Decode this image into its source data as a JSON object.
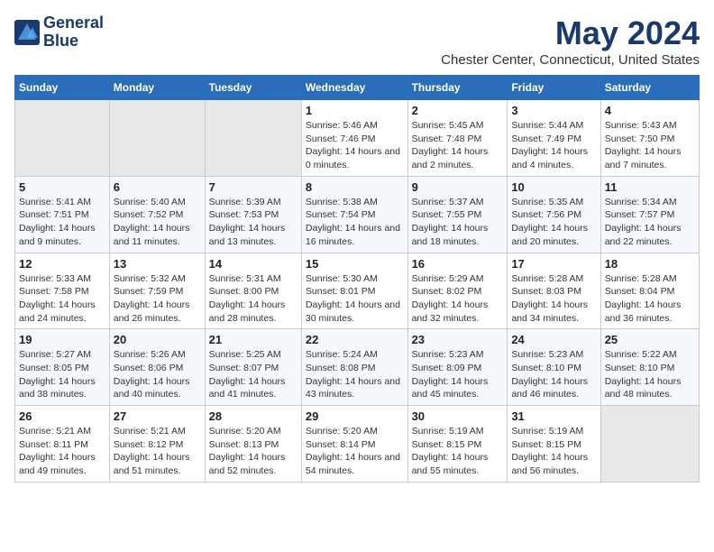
{
  "header": {
    "logo_line1": "General",
    "logo_line2": "Blue",
    "title": "May 2024",
    "subtitle": "Chester Center, Connecticut, United States"
  },
  "weekdays": [
    "Sunday",
    "Monday",
    "Tuesday",
    "Wednesday",
    "Thursday",
    "Friday",
    "Saturday"
  ],
  "weeks": [
    [
      {
        "day": "",
        "empty": true
      },
      {
        "day": "",
        "empty": true
      },
      {
        "day": "",
        "empty": true
      },
      {
        "day": "1",
        "sunrise": "Sunrise: 5:46 AM",
        "sunset": "Sunset: 7:46 PM",
        "daylight": "Daylight: 14 hours and 0 minutes."
      },
      {
        "day": "2",
        "sunrise": "Sunrise: 5:45 AM",
        "sunset": "Sunset: 7:48 PM",
        "daylight": "Daylight: 14 hours and 2 minutes."
      },
      {
        "day": "3",
        "sunrise": "Sunrise: 5:44 AM",
        "sunset": "Sunset: 7:49 PM",
        "daylight": "Daylight: 14 hours and 4 minutes."
      },
      {
        "day": "4",
        "sunrise": "Sunrise: 5:43 AM",
        "sunset": "Sunset: 7:50 PM",
        "daylight": "Daylight: 14 hours and 7 minutes."
      }
    ],
    [
      {
        "day": "5",
        "sunrise": "Sunrise: 5:41 AM",
        "sunset": "Sunset: 7:51 PM",
        "daylight": "Daylight: 14 hours and 9 minutes."
      },
      {
        "day": "6",
        "sunrise": "Sunrise: 5:40 AM",
        "sunset": "Sunset: 7:52 PM",
        "daylight": "Daylight: 14 hours and 11 minutes."
      },
      {
        "day": "7",
        "sunrise": "Sunrise: 5:39 AM",
        "sunset": "Sunset: 7:53 PM",
        "daylight": "Daylight: 14 hours and 13 minutes."
      },
      {
        "day": "8",
        "sunrise": "Sunrise: 5:38 AM",
        "sunset": "Sunset: 7:54 PM",
        "daylight": "Daylight: 14 hours and 16 minutes."
      },
      {
        "day": "9",
        "sunrise": "Sunrise: 5:37 AM",
        "sunset": "Sunset: 7:55 PM",
        "daylight": "Daylight: 14 hours and 18 minutes."
      },
      {
        "day": "10",
        "sunrise": "Sunrise: 5:35 AM",
        "sunset": "Sunset: 7:56 PM",
        "daylight": "Daylight: 14 hours and 20 minutes."
      },
      {
        "day": "11",
        "sunrise": "Sunrise: 5:34 AM",
        "sunset": "Sunset: 7:57 PM",
        "daylight": "Daylight: 14 hours and 22 minutes."
      }
    ],
    [
      {
        "day": "12",
        "sunrise": "Sunrise: 5:33 AM",
        "sunset": "Sunset: 7:58 PM",
        "daylight": "Daylight: 14 hours and 24 minutes."
      },
      {
        "day": "13",
        "sunrise": "Sunrise: 5:32 AM",
        "sunset": "Sunset: 7:59 PM",
        "daylight": "Daylight: 14 hours and 26 minutes."
      },
      {
        "day": "14",
        "sunrise": "Sunrise: 5:31 AM",
        "sunset": "Sunset: 8:00 PM",
        "daylight": "Daylight: 14 hours and 28 minutes."
      },
      {
        "day": "15",
        "sunrise": "Sunrise: 5:30 AM",
        "sunset": "Sunset: 8:01 PM",
        "daylight": "Daylight: 14 hours and 30 minutes."
      },
      {
        "day": "16",
        "sunrise": "Sunrise: 5:29 AM",
        "sunset": "Sunset: 8:02 PM",
        "daylight": "Daylight: 14 hours and 32 minutes."
      },
      {
        "day": "17",
        "sunrise": "Sunrise: 5:28 AM",
        "sunset": "Sunset: 8:03 PM",
        "daylight": "Daylight: 14 hours and 34 minutes."
      },
      {
        "day": "18",
        "sunrise": "Sunrise: 5:28 AM",
        "sunset": "Sunset: 8:04 PM",
        "daylight": "Daylight: 14 hours and 36 minutes."
      }
    ],
    [
      {
        "day": "19",
        "sunrise": "Sunrise: 5:27 AM",
        "sunset": "Sunset: 8:05 PM",
        "daylight": "Daylight: 14 hours and 38 minutes."
      },
      {
        "day": "20",
        "sunrise": "Sunrise: 5:26 AM",
        "sunset": "Sunset: 8:06 PM",
        "daylight": "Daylight: 14 hours and 40 minutes."
      },
      {
        "day": "21",
        "sunrise": "Sunrise: 5:25 AM",
        "sunset": "Sunset: 8:07 PM",
        "daylight": "Daylight: 14 hours and 41 minutes."
      },
      {
        "day": "22",
        "sunrise": "Sunrise: 5:24 AM",
        "sunset": "Sunset: 8:08 PM",
        "daylight": "Daylight: 14 hours and 43 minutes."
      },
      {
        "day": "23",
        "sunrise": "Sunrise: 5:23 AM",
        "sunset": "Sunset: 8:09 PM",
        "daylight": "Daylight: 14 hours and 45 minutes."
      },
      {
        "day": "24",
        "sunrise": "Sunrise: 5:23 AM",
        "sunset": "Sunset: 8:10 PM",
        "daylight": "Daylight: 14 hours and 46 minutes."
      },
      {
        "day": "25",
        "sunrise": "Sunrise: 5:22 AM",
        "sunset": "Sunset: 8:10 PM",
        "daylight": "Daylight: 14 hours and 48 minutes."
      }
    ],
    [
      {
        "day": "26",
        "sunrise": "Sunrise: 5:21 AM",
        "sunset": "Sunset: 8:11 PM",
        "daylight": "Daylight: 14 hours and 49 minutes."
      },
      {
        "day": "27",
        "sunrise": "Sunrise: 5:21 AM",
        "sunset": "Sunset: 8:12 PM",
        "daylight": "Daylight: 14 hours and 51 minutes."
      },
      {
        "day": "28",
        "sunrise": "Sunrise: 5:20 AM",
        "sunset": "Sunset: 8:13 PM",
        "daylight": "Daylight: 14 hours and 52 minutes."
      },
      {
        "day": "29",
        "sunrise": "Sunrise: 5:20 AM",
        "sunset": "Sunset: 8:14 PM",
        "daylight": "Daylight: 14 hours and 54 minutes."
      },
      {
        "day": "30",
        "sunrise": "Sunrise: 5:19 AM",
        "sunset": "Sunset: 8:15 PM",
        "daylight": "Daylight: 14 hours and 55 minutes."
      },
      {
        "day": "31",
        "sunrise": "Sunrise: 5:19 AM",
        "sunset": "Sunset: 8:15 PM",
        "daylight": "Daylight: 14 hours and 56 minutes."
      },
      {
        "day": "",
        "empty": true
      }
    ]
  ]
}
